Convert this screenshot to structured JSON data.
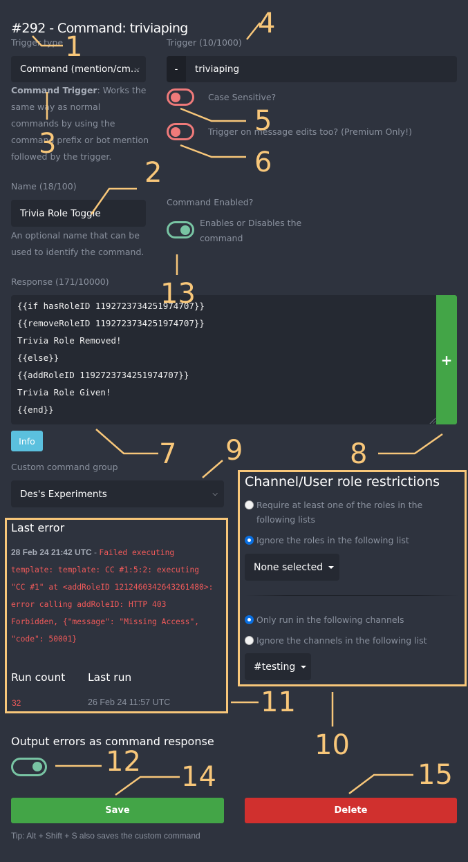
{
  "page": {
    "title": "#292 - Command: triviaping"
  },
  "trigger_type": {
    "label": "Trigger type",
    "selected": "Command (mention/cm...",
    "help_bold": "Command Trigger",
    "help_text": ": Works the same way as normal commands by using the command prefix or bot mention followed by the trigger."
  },
  "trigger": {
    "label": "Trigger (10/1000)",
    "prefix": "-",
    "value": "triviaping"
  },
  "toggles": {
    "case_sensitive": {
      "label": "Case Sensitive?",
      "enabled": false
    },
    "trigger_on_edits": {
      "label": "Trigger on message edits too? (Premium Only!)",
      "enabled": false
    },
    "command_enabled": {
      "heading": "Command Enabled?",
      "label": "Enables or Disables the command",
      "enabled": true
    },
    "output_errors": {
      "heading": "Output errors as command response",
      "enabled": true
    }
  },
  "name": {
    "label": "Name (18/100)",
    "value": "Trivia Role Toggle",
    "help": "An optional name that can be used to identify the command."
  },
  "response": {
    "label": "Response (171/10000)",
    "lines": [
      "{{if hasRoleID 1192723734251974707}}",
      "{{removeRoleID 1192723734251974707}}",
      "Trivia Role Removed!",
      "{{else}}",
      "{{addRoleID 1192723734251974707}}",
      "Trivia Role Given!",
      "{{end}}"
    ],
    "add_button": "+",
    "info_button": "Info"
  },
  "group": {
    "label": "Custom command group",
    "selected": "Des's Experiments"
  },
  "last_error": {
    "heading": "Last error",
    "timestamp": "28 Feb 24 21:42 UTC",
    "separator": " - ",
    "message_lines": [
      "Failed executing",
      "template: template: CC #1:5:2: executing",
      "\"CC #1\" at <addRoleID 1212460342643261480>:",
      "error calling addRoleID: HTTP 403",
      "Forbidden, {\"message\": \"Missing Access\",",
      "\"code\": 50001}"
    ],
    "run_count_label": "Run count",
    "last_run_label": "Last run",
    "run_count": "32",
    "last_run": "26 Feb 24 11:57 UTC"
  },
  "restrictions": {
    "heading": "Channel/User role restrictions",
    "role_options": [
      {
        "label": "Require at least one of the roles in the following lists",
        "checked": false
      },
      {
        "label": "Ignore the roles in the following list",
        "checked": true
      }
    ],
    "roles_dropdown": "None selected",
    "channel_options": [
      {
        "label": "Only run in the following channels",
        "checked": true
      },
      {
        "label": "Ignore the channels in the following list",
        "checked": false
      }
    ],
    "channels_dropdown": "#testing"
  },
  "actions": {
    "save": "Save",
    "delete": "Delete",
    "tip": "Tip: Alt + Shift + S also saves the custom command"
  },
  "annotations": {
    "color": "#f8c77a",
    "labels": [
      "1",
      "2",
      "3",
      "4",
      "5",
      "6",
      "7",
      "8",
      "9",
      "10",
      "11",
      "12",
      "13",
      "14",
      "15"
    ]
  }
}
